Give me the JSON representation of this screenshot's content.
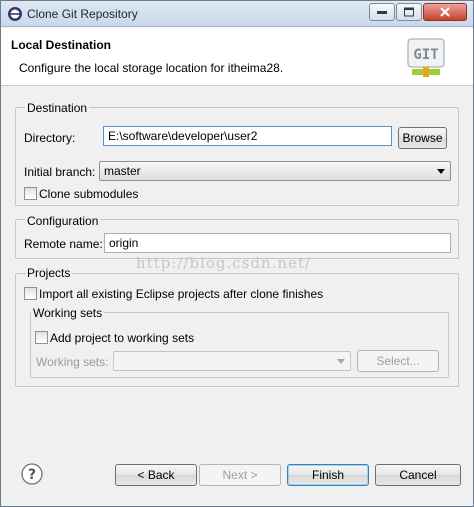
{
  "window": {
    "title": "Clone Git Repository"
  },
  "banner": {
    "title": "Local Destination",
    "description": "Configure the local storage location for itheima28."
  },
  "destination": {
    "group_title": "Destination",
    "directory_label": "Directory:",
    "directory_value": "E:\\software\\developer\\user2",
    "browse_label": "Browse",
    "branch_label": "Initial branch:",
    "branch_value": "master",
    "clone_submodules_label": "Clone submodules",
    "clone_submodules_checked": false
  },
  "configuration": {
    "group_title": "Configuration",
    "remote_label": "Remote name:",
    "remote_value": "origin"
  },
  "projects": {
    "group_title": "Projects",
    "import_label": "Import all existing Eclipse projects after clone finishes",
    "import_checked": false,
    "working_sets": {
      "group_title": "Working sets",
      "add_label": "Add project to working sets",
      "add_checked": false,
      "sets_label": "Working sets:",
      "sets_value": "",
      "select_label": "Select..."
    }
  },
  "watermark": "http://blog.csdn.net/",
  "footer": {
    "back_label": "< Back",
    "next_label": "Next >",
    "finish_label": "Finish",
    "cancel_label": "Cancel"
  },
  "icons": {
    "app": "eclipse-icon",
    "banner": "git-logo-icon",
    "help": "help-icon"
  }
}
